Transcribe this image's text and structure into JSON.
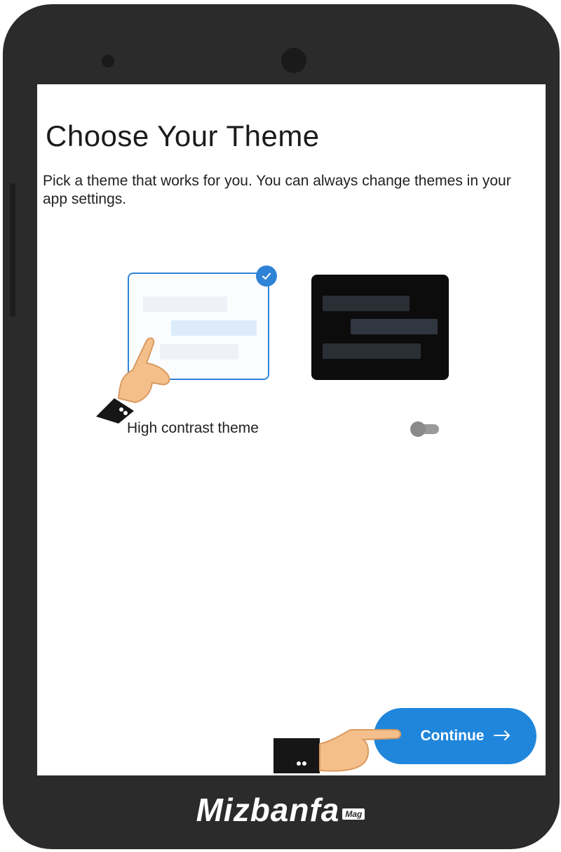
{
  "screen": {
    "title": "Choose Your Theme",
    "description": "Pick a theme that works for you. You can always change themes in your app settings."
  },
  "themes": [
    {
      "name": "light",
      "selected": true,
      "border_color": "#2f83d7"
    },
    {
      "name": "dark",
      "selected": false,
      "background": "#0c0c0c"
    }
  ],
  "high_contrast": {
    "label": "High contrast theme",
    "enabled": false
  },
  "continue_button": {
    "label": "Continue",
    "icon": "arrow-right-icon",
    "color": "#1f86dc"
  },
  "watermark": {
    "brand": "Mizbanfa",
    "badge": "Mag"
  },
  "colors": {
    "accent": "#2f83d7",
    "phone_body": "#2b2b2b"
  }
}
